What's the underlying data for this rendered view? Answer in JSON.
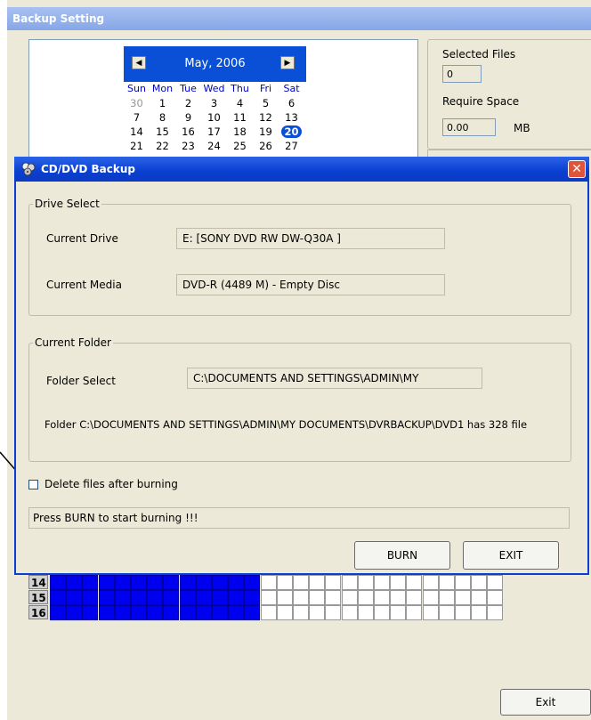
{
  "background_window": {
    "title": "Backup Setting",
    "calendar": {
      "month_label": "May, 2006",
      "weekdays": [
        "Sun",
        "Mon",
        "Tue",
        "Wed",
        "Thu",
        "Fri",
        "Sat"
      ],
      "rows": [
        [
          "30",
          "1",
          "2",
          "3",
          "4",
          "5",
          "6"
        ],
        [
          "7",
          "8",
          "9",
          "10",
          "11",
          "12",
          "13"
        ],
        [
          "14",
          "15",
          "16",
          "17",
          "18",
          "19",
          "20"
        ],
        [
          "21",
          "22",
          "23",
          "24",
          "25",
          "26",
          "27"
        ]
      ],
      "selected_day": "20"
    },
    "selected_files_label": "Selected Files",
    "selected_files_value": "0",
    "require_space_label": "Require Space",
    "require_space_value": "0.00",
    "require_space_unit": "MB",
    "grid_rows": [
      {
        "label": "14",
        "filled": 13,
        "total": 28
      },
      {
        "label": "15",
        "filled": 13,
        "total": 28
      },
      {
        "label": "16",
        "filled": 13,
        "total": 28
      }
    ],
    "exit_label": "Exit"
  },
  "dialog": {
    "title": "CD/DVD Backup",
    "close_glyph": "✕",
    "drive_select": {
      "legend": "Drive Select",
      "current_drive_label": "Current Drive",
      "current_drive_value": "E: [SONY     DVD RW DW-Q30A  ]",
      "current_media_label": "Current Media",
      "current_media_value": "DVD-R (4489 M) -  Empty Disc"
    },
    "current_folder": {
      "legend": "Current Folder",
      "folder_select_label": "Folder Select",
      "folder_select_value": "C:\\DOCUMENTS AND SETTINGS\\ADMIN\\MY",
      "folder_info": "Folder C:\\DOCUMENTS AND SETTINGS\\ADMIN\\MY DOCUMENTS\\DVRBACKUP\\DVD1 has 328 file"
    },
    "delete_checkbox_label": "Delete files after burning",
    "delete_checked": false,
    "status_text": "Press BURN to start burning !!!",
    "burn_label": "BURN",
    "exit_label": "EXIT"
  }
}
